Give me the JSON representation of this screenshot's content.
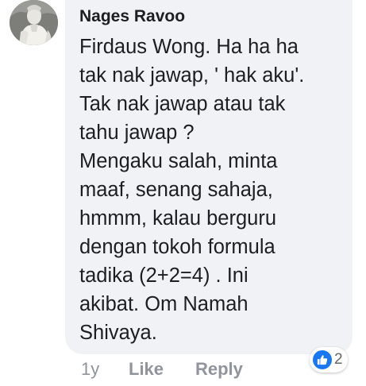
{
  "comment": {
    "author": "Nages Ravoo",
    "lines": [
      "Firdaus Wong. Ha ha ha",
      "tak nak jawap, ' hak aku'.",
      "Tak nak jawap atau tak",
      "tahu jawap ?",
      "Mengaku salah, minta",
      "maaf, senang sahaja,",
      "hmmm, kalau berguru",
      "dengan tokoh formula",
      "tadika (2+2=4) . Ini",
      "akibat. Om Namah",
      "Shivaya."
    ]
  },
  "actions": {
    "time": "1y",
    "like_label": "Like",
    "reply_label": "Reply"
  },
  "reactions": {
    "icon": "thumbs-up-icon",
    "count": "2",
    "color": "#1877f2"
  },
  "colors": {
    "bubble": "#f0f2f5",
    "text": "#1c1e21",
    "meta": "#90949c"
  }
}
